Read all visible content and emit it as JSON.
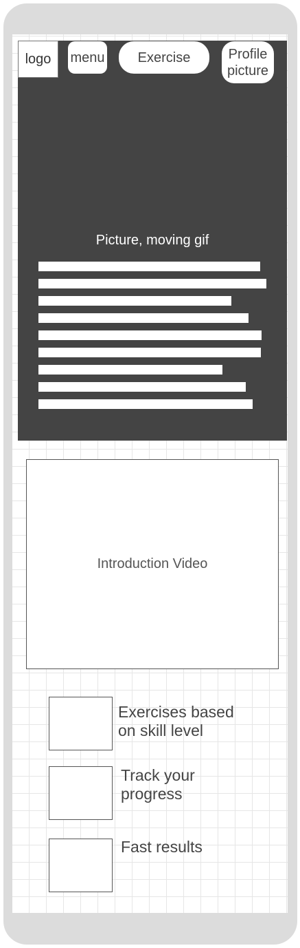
{
  "header": {
    "logo": "logo",
    "menu": "menu",
    "exercise": "Exercise",
    "profile": "Profile\npicture"
  },
  "hero": {
    "caption": "Picture, moving gif",
    "placeholder_lines": 9
  },
  "video": {
    "label": "Introduction Video"
  },
  "features": [
    {
      "label": "Exercises based\non skill level"
    },
    {
      "label": "Track your\nprogress"
    },
    {
      "label": "Fast results"
    }
  ],
  "colors": {
    "frame": "#dcdcdc",
    "hero": "#444444",
    "grid": "#e6e6e6"
  }
}
